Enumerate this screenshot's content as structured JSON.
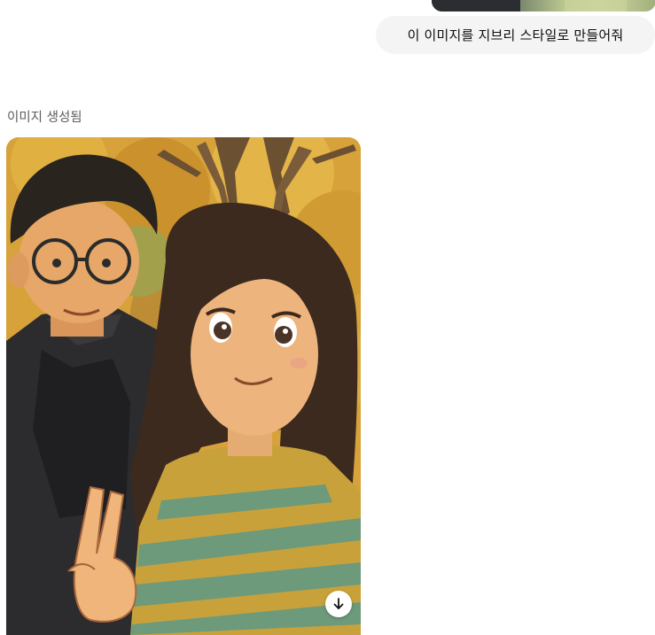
{
  "conversation": {
    "user_message": "이 이미지를 지브리 스타일로 만들어줘",
    "assistant_status": "이미지 생성됨"
  },
  "icons": {
    "download": "arrow-down-icon"
  },
  "colors": {
    "bubble_bg": "#f4f4f4",
    "status_text": "#5d5d5d",
    "image_bg": "#d9a534"
  }
}
